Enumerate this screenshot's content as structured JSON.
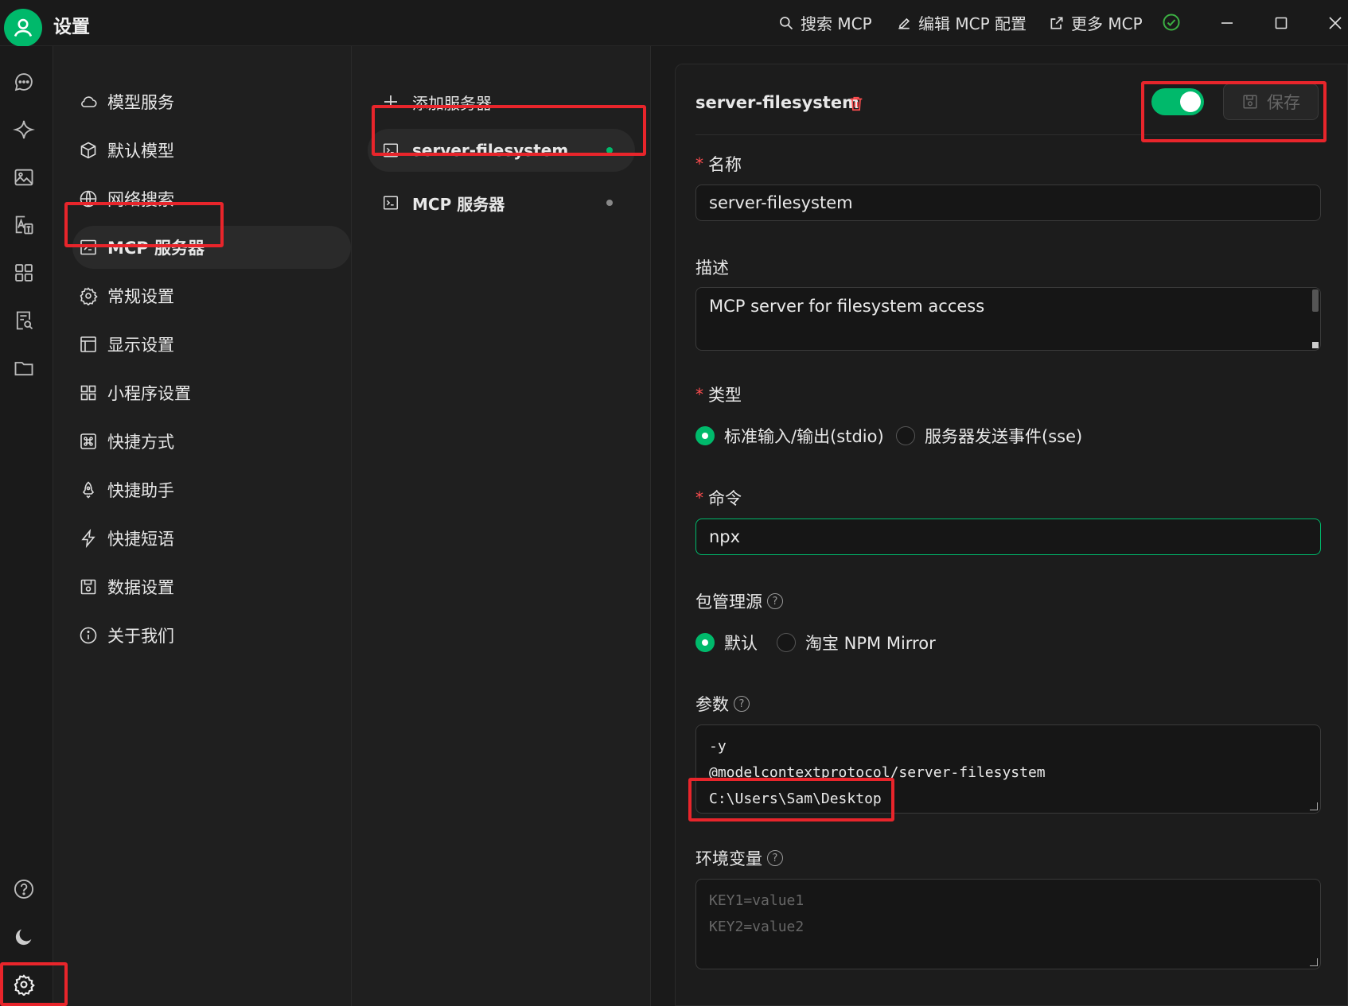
{
  "window": {
    "title": "设置",
    "actions": {
      "search": "搜索 MCP",
      "edit": "编辑 MCP 配置",
      "more": "更多 MCP"
    }
  },
  "settings_nav": {
    "items": [
      {
        "label": "模型服务",
        "icon": "cloud-icon"
      },
      {
        "label": "默认模型",
        "icon": "cube-icon"
      },
      {
        "label": "网络搜索",
        "icon": "globe-icon"
      },
      {
        "label": "MCP 服务器",
        "icon": "terminal-icon",
        "active": true
      },
      {
        "label": "常规设置",
        "icon": "gear-icon"
      },
      {
        "label": "显示设置",
        "icon": "layout-icon"
      },
      {
        "label": "小程序设置",
        "icon": "grid-icon"
      },
      {
        "label": "快捷方式",
        "icon": "command-icon"
      },
      {
        "label": "快捷助手",
        "icon": "rocket-icon"
      },
      {
        "label": "快捷短语",
        "icon": "zap-icon"
      },
      {
        "label": "数据设置",
        "icon": "save-icon"
      },
      {
        "label": "关于我们",
        "icon": "info-icon"
      }
    ]
  },
  "server_list": {
    "add_label": "添加服务器",
    "items": [
      {
        "name": "server-filesystem",
        "status": "active"
      },
      {
        "name": "MCP 服务器",
        "status": "inactive"
      }
    ]
  },
  "detail": {
    "title": "server-filesystem",
    "save_label": "保存",
    "enabled": true,
    "name_label": "名称",
    "name_value": "server-filesystem",
    "desc_label": "描述",
    "desc_value": "MCP server for filesystem access",
    "type_label": "类型",
    "type_options": [
      "标准输入/输出(stdio)",
      "服务器发送事件(sse)"
    ],
    "type_selected": "标准输入/输出(stdio)",
    "command_label": "命令",
    "command_value": "npx",
    "registry_label": "包管理源",
    "registry_options": [
      "默认",
      "淘宝 NPM Mirror"
    ],
    "registry_selected": "默认",
    "args_label": "参数",
    "args_lines": [
      "-y",
      "@modelcontextprotocol/server-filesystem",
      "C:\\Users\\Sam\\Desktop"
    ],
    "env_label": "环境变量",
    "env_placeholder_lines": [
      "KEY1=value1",
      "KEY2=value2"
    ]
  },
  "colors": {
    "accent": "#00b96b",
    "highlight": "#e8252b",
    "danger": "#ff4d4f"
  }
}
